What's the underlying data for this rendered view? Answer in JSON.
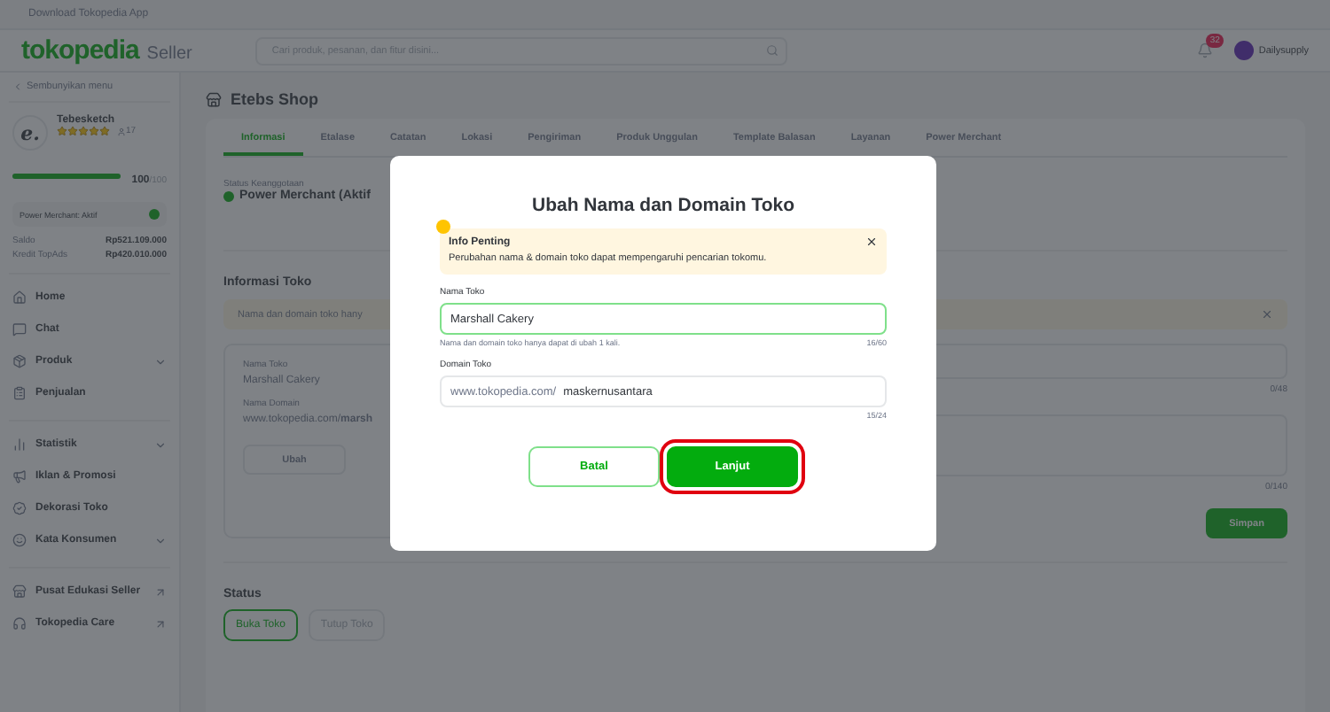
{
  "top_strip": {
    "label": "Download Tokopedia App"
  },
  "header": {
    "logo": "tokopedia",
    "logo_suffix": "Seller",
    "search": {
      "placeholder": "Cari produk, pesanan, dan fitur disini..."
    },
    "notification_count": "32",
    "user": "Dailysupply"
  },
  "sidebar": {
    "hide_menu": "Sembunyikan menu",
    "profile": {
      "avatar_letter": "e.",
      "name": "Tebesketch",
      "stars": 5,
      "followers": "17",
      "level": 1,
      "score": "100",
      "score_max": "/100",
      "badge": "Power Merchant: Aktif"
    },
    "balances": [
      {
        "label": "Saldo",
        "value": "Rp521.109.000"
      },
      {
        "label": "Kredit TopAds",
        "value": "Rp420.010.000"
      }
    ],
    "groups": [
      [
        {
          "label": "Home",
          "kind": "plain"
        },
        {
          "label": "Chat",
          "kind": "plain"
        },
        {
          "label": "Produk",
          "kind": "expandable"
        },
        {
          "label": "Penjualan",
          "kind": "plain"
        }
      ],
      [
        {
          "label": "Statistik",
          "kind": "expandable"
        },
        {
          "label": "Iklan & Promosi",
          "kind": "plain"
        },
        {
          "label": "Dekorasi Toko",
          "kind": "plain"
        },
        {
          "label": "Kata Konsumen",
          "kind": "expandable"
        }
      ],
      [
        {
          "label": "Pusat Edukasi Seller",
          "kind": "external"
        },
        {
          "label": "Tokopedia Care",
          "kind": "external"
        }
      ]
    ]
  },
  "page": {
    "title": "Etebs Shop",
    "tabs": [
      {
        "label": "Informasi",
        "selected": true
      },
      {
        "label": "Etalase",
        "selected": false
      },
      {
        "label": "Catatan",
        "selected": false
      },
      {
        "label": "Lokasi",
        "selected": false
      },
      {
        "label": "Pengiriman",
        "selected": false
      },
      {
        "label": "Produk Unggulan",
        "selected": false
      },
      {
        "label": "Template Balasan",
        "selected": false
      },
      {
        "label": "Layanan",
        "selected": false
      },
      {
        "label": "Power Merchant",
        "selected": false
      }
    ],
    "membership": {
      "label": "Status Keanggotaan",
      "value": "Power Merchant (Aktif"
    },
    "info_section": {
      "title": "Informasi Toko",
      "banner": "Nama dan domain toko hany",
      "name_label": "Nama Toko",
      "name_value": "Marshall Cakery",
      "domain_label": "Nama Domain",
      "domain_value": "www.tokopedia.com/**marsh**",
      "edit_button": "Ubah",
      "counter_1": "0/48",
      "counter_2": "0/140",
      "save_button": "Simpan"
    },
    "status": {
      "title": "Status",
      "options": [
        {
          "label": "Buka Toko",
          "selected": true
        },
        {
          "label": "Tutup Toko",
          "selected": false
        }
      ]
    }
  },
  "dialog": {
    "title": "Ubah Nama dan Domain Toko",
    "notice": {
      "title": "Info Penting",
      "text": "Perubahan nama & domain toko dapat mempengaruhi pencarian tokomu."
    },
    "name_field": {
      "label": "Nama Toko",
      "value": "Marshall Cakery",
      "focused": true,
      "hint": "Nama dan domain toko hanya dapat di ubah 1 kali.",
      "counter": "16/60"
    },
    "domain_field": {
      "label": "Domain Toko",
      "prefix": "www.tokopedia.com/",
      "value": "maskernusantara",
      "counter": "15/24"
    },
    "buttons": [
      {
        "label": "Batal",
        "kind": "secondary",
        "highlighted": false
      },
      {
        "label": "Lanjut",
        "kind": "primary",
        "highlighted": true
      }
    ]
  }
}
